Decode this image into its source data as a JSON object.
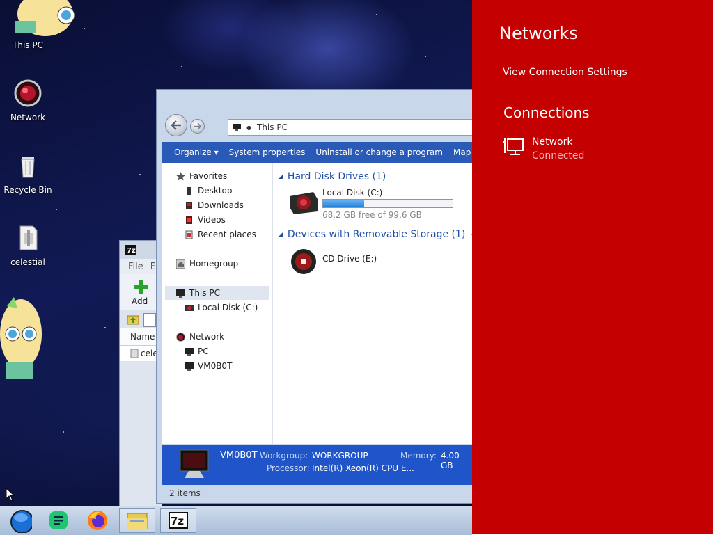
{
  "desktop": {
    "icons": [
      {
        "label": "This PC"
      },
      {
        "label": "Network"
      },
      {
        "label": "Recycle Bin"
      },
      {
        "label": "celestial"
      }
    ]
  },
  "zip_window": {
    "menu_file": "File",
    "menu_edit": "E",
    "add_label": "Add",
    "column_name": "Name",
    "row_partial": "celes"
  },
  "explorer": {
    "address": "This PC",
    "commands": [
      "Organize ▾",
      "System properties",
      "Uninstall or change a program",
      "Map"
    ],
    "nav": {
      "favorites": "Favorites",
      "desktop": "Desktop",
      "downloads": "Downloads",
      "videos": "Videos",
      "recent": "Recent places",
      "homegroup": "Homegroup",
      "this_pc": "This PC",
      "local_disk": "Local Disk (C:)",
      "network": "Network",
      "pc": "PC",
      "vm": "VM0B0T"
    },
    "groups": {
      "hdd": "Hard Disk Drives (1)",
      "removable": "Devices with Removable Storage (1)"
    },
    "drive_c": {
      "name": "Local Disk (C:)",
      "free_text": "68.2 GB free of 99.6 GB",
      "used_fraction": 0.315
    },
    "drive_e": {
      "name": "CD Drive (E:)"
    },
    "details": {
      "computer_name": "VM0B0T",
      "workgroup_label": "Workgroup:",
      "workgroup_value": "WORKGROUP",
      "memory_label": "Memory:",
      "memory_value": "4.00 GB",
      "processor_label": "Processor:",
      "processor_value": "Intel(R) Xeon(R) CPU E..."
    },
    "status": "2 items"
  },
  "flyout": {
    "title": "Networks",
    "settings_link": "View Connection Settings",
    "section": "Connections",
    "network_name": "Network",
    "network_status": "Connected"
  },
  "taskbar": {
    "items": [
      "start-orb",
      "notes-app",
      "firefox",
      "file-explorer",
      "7zip"
    ],
    "zip_label": "7z"
  },
  "colors": {
    "flyout_bg": "#c40000",
    "cmdbar_bg": "#2a5ab8",
    "details_bg": "#1f55c8",
    "group_header": "#1f4fa6"
  }
}
